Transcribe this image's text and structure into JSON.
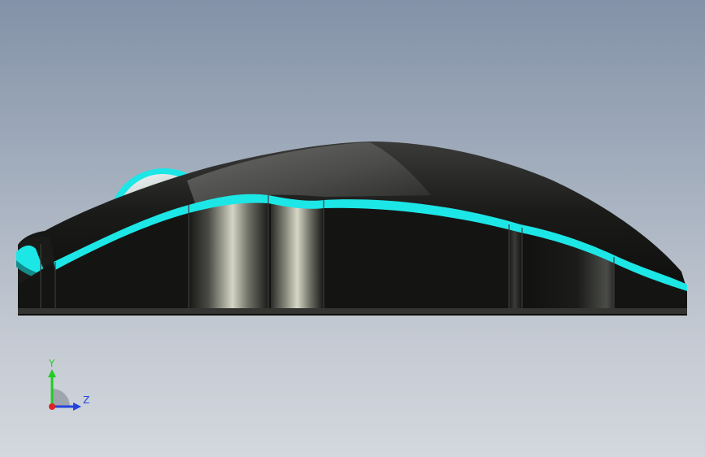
{
  "viewport": {
    "background_top": "#8392a8",
    "background_bottom": "#d3d8de"
  },
  "model": {
    "body_color": "#141513",
    "accent_color": "#1de6e6",
    "wheel_color": "#d9e4e4"
  },
  "triad": {
    "y_label": "Y",
    "z_label": "Z",
    "y_color": "#22cc22",
    "z_color": "#2244dd",
    "x_color": "#dd2222"
  }
}
